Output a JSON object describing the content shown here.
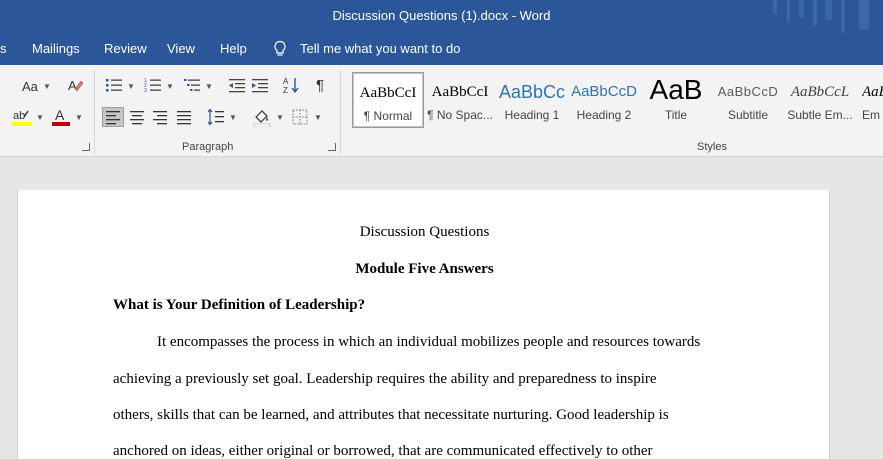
{
  "window": {
    "title": "Discussion Questions (1).docx  -  Word"
  },
  "tabs": [
    {
      "label": "s"
    },
    {
      "label": "Mailings"
    },
    {
      "label": "Review"
    },
    {
      "label": "View"
    },
    {
      "label": "Help"
    }
  ],
  "tell_me": {
    "label": "Tell me what you want to do",
    "icon": "lightbulb-icon"
  },
  "ribbon": {
    "font_group": {
      "change_case_label": "Aa",
      "highlight_color": "#ffff00",
      "font_color": "#c00000"
    },
    "paragraph_group": {
      "label": "Paragraph"
    },
    "styles_group": {
      "label": "Styles",
      "items": [
        {
          "sample": "AaBbCcI",
          "name": "¶ Normal",
          "selected": true,
          "color": "#000000"
        },
        {
          "sample": "AaBbCcI",
          "name": "¶ No Spac...",
          "color": "#000000"
        },
        {
          "sample": "AaBbCc",
          "name": "Heading 1",
          "color": "#2e74b5"
        },
        {
          "sample": "AaBbCcD",
          "name": "Heading 2",
          "color": "#2e74b5"
        },
        {
          "sample": "AaB",
          "name": "Title",
          "color": "#000000"
        },
        {
          "sample": "AaBbCcD",
          "name": "Subtitle",
          "color": "#5a5a5a"
        },
        {
          "sample": "AaBbCcL",
          "name": "Subtle Em...",
          "color": "#404040"
        },
        {
          "sample": "AaB",
          "name": "Em",
          "color": "#000000"
        }
      ]
    }
  },
  "document": {
    "title": "Discussion Questions",
    "subtitle": "Module Five Answers",
    "heading": "What is Your Definition of Leadership?",
    "lines": [
      "It encompasses the process in which an individual mobilizes people and resources towards",
      "achieving a previously set goal. Leadership requires the ability and preparedness to inspire",
      "others, skills that can be learned, and attributes that necessitate nurturing. Good leadership is",
      "anchored on ideas, either original or borrowed, that are communicated effectively to other"
    ]
  }
}
